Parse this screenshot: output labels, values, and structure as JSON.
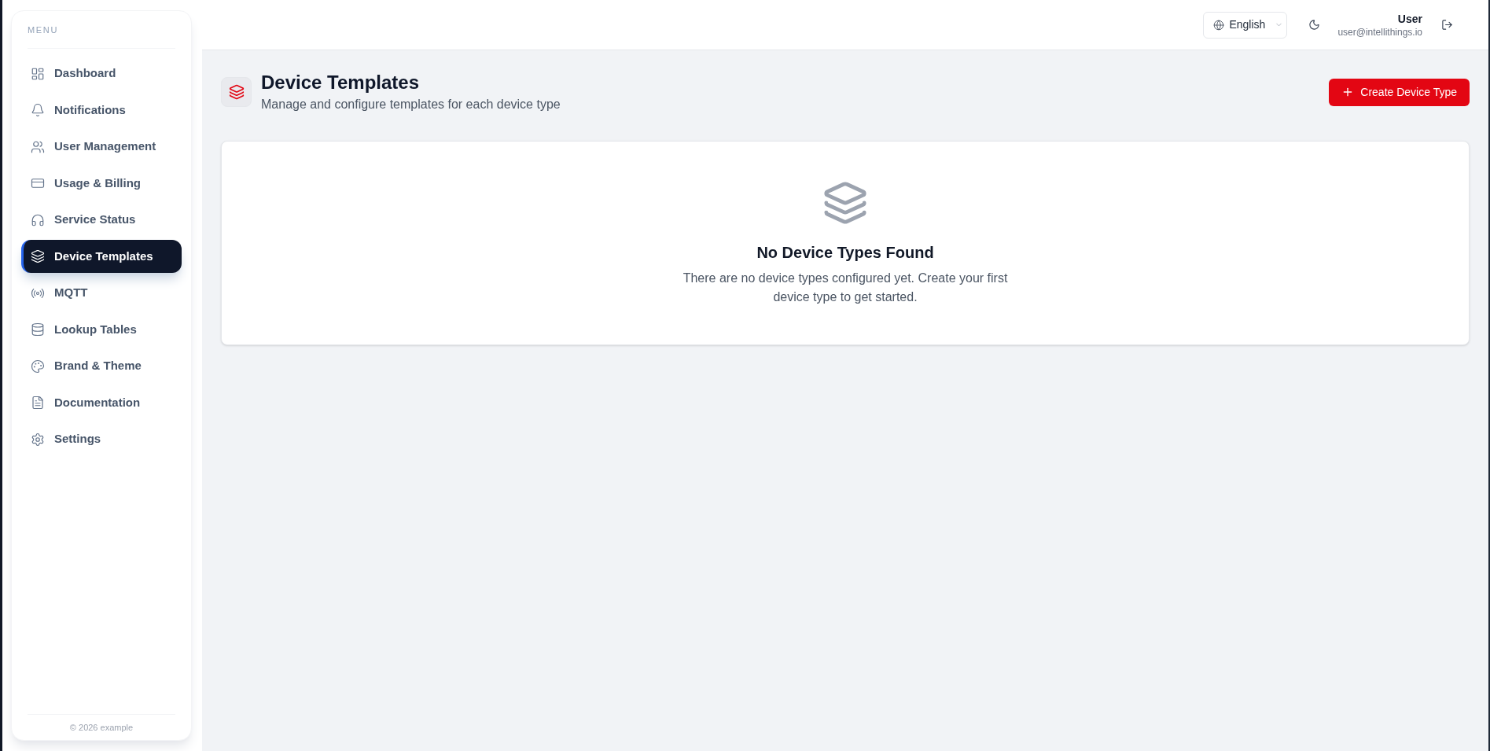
{
  "sidebar": {
    "heading": "MENU",
    "items": [
      {
        "label": "Dashboard",
        "selected": false
      },
      {
        "label": "Notifications",
        "selected": false
      },
      {
        "label": "User Management",
        "selected": false
      },
      {
        "label": "Usage & Billing",
        "selected": false
      },
      {
        "label": "Service Status",
        "selected": false
      },
      {
        "label": "Device Templates",
        "selected": true
      },
      {
        "label": "MQTT",
        "selected": false
      },
      {
        "label": "Lookup Tables",
        "selected": false
      },
      {
        "label": "Brand & Theme",
        "selected": false
      },
      {
        "label": "Documentation",
        "selected": false
      },
      {
        "label": "Settings",
        "selected": false
      }
    ],
    "footer": "© 2026 example"
  },
  "header": {
    "language": "English",
    "user": {
      "name": "User",
      "email": "user@intellithings.io"
    }
  },
  "page": {
    "title": "Device Templates",
    "subtitle": "Manage and configure templates for each device type",
    "create_button": "Create Device Type"
  },
  "empty_state": {
    "title": "No Device Types Found",
    "message": "There are no device types configured yet. Create your first device type to get started."
  }
}
